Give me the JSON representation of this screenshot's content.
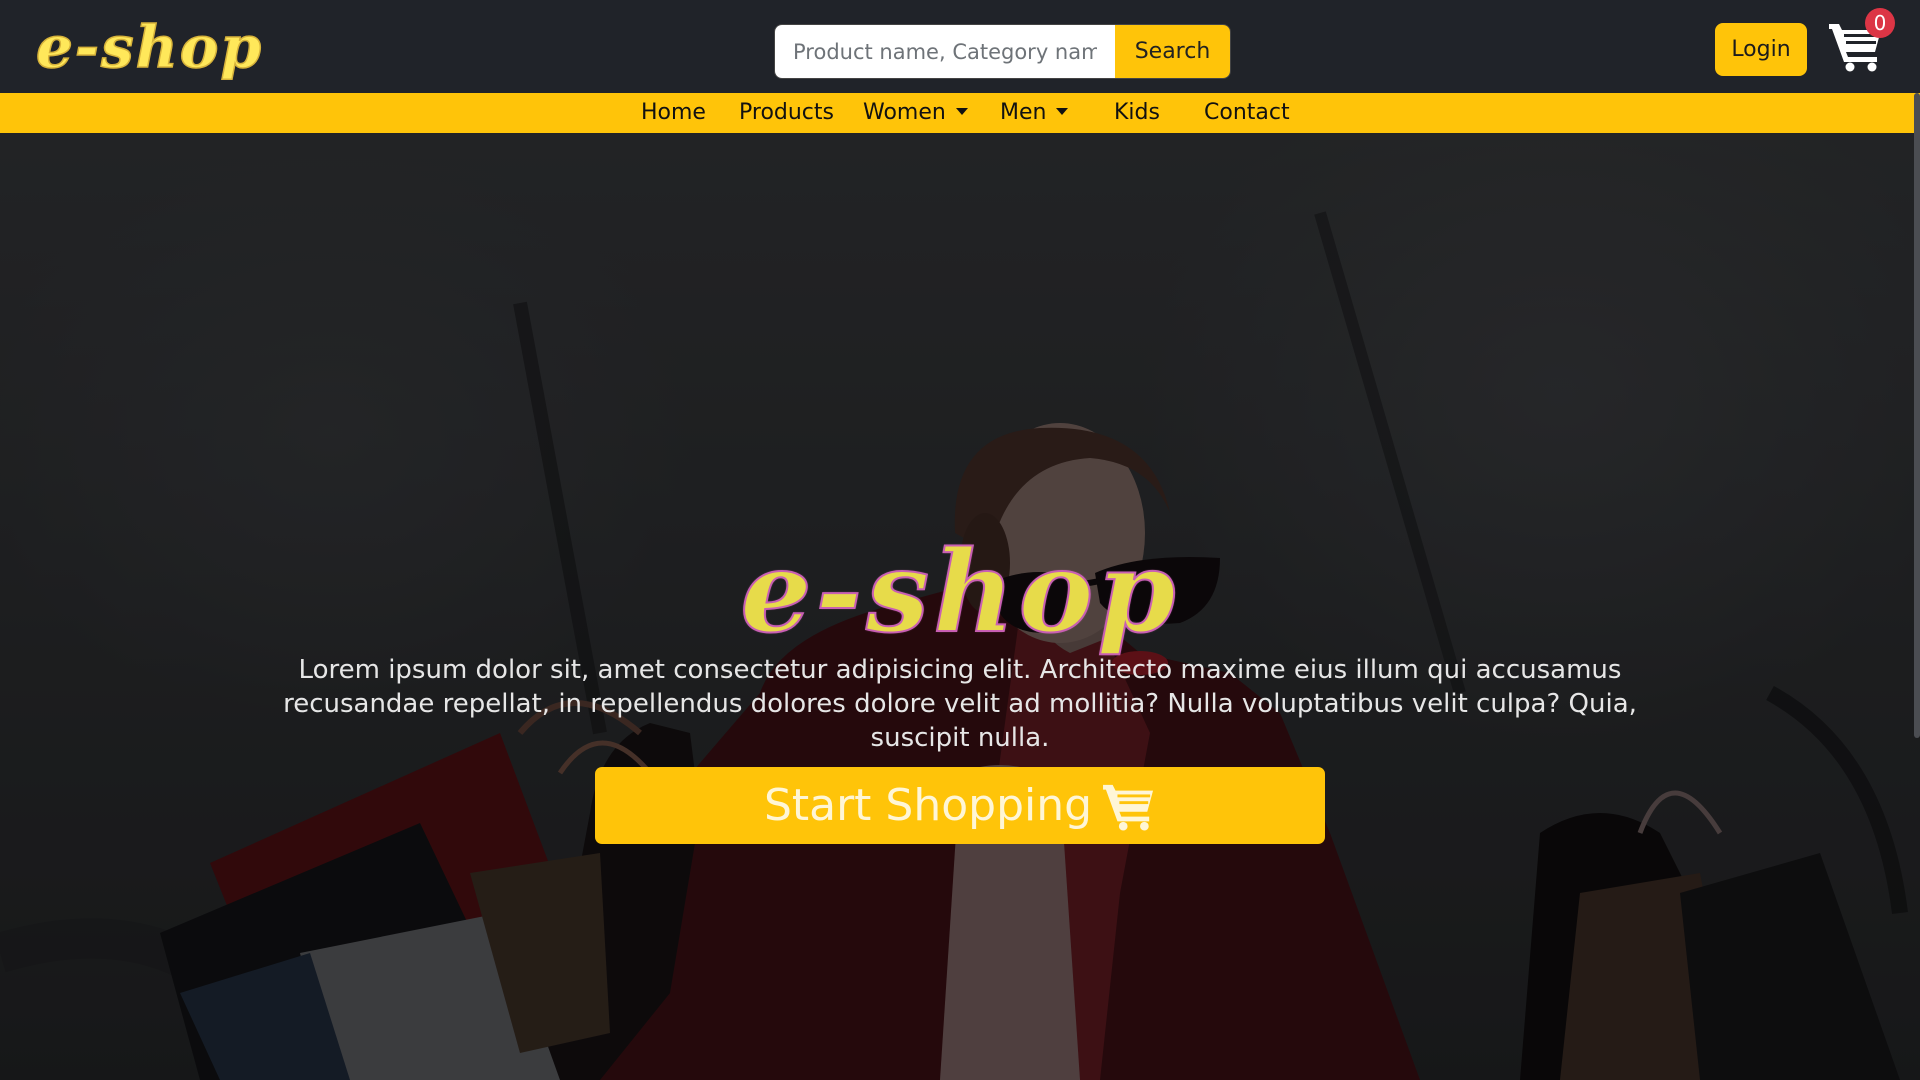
{
  "header": {
    "logo_text": "e-shop",
    "search": {
      "placeholder": "Product name, Category name",
      "value": "",
      "button_label": "Search"
    },
    "login_label": "Login",
    "cart": {
      "icon": "shopping-cart-icon",
      "count": "0"
    }
  },
  "nav": {
    "items": [
      {
        "label": "Home",
        "dropdown": false
      },
      {
        "label": "Products",
        "dropdown": false
      },
      {
        "label": "Women",
        "dropdown": true
      },
      {
        "label": "Men",
        "dropdown": true
      },
      {
        "label": "Kids",
        "dropdown": false
      },
      {
        "label": "Contact",
        "dropdown": false
      }
    ]
  },
  "hero": {
    "title": "e-shop",
    "text": "Lorem ipsum dolor sit, amet consectetur adipisicing elit. Architecto maxime eius illum qui accusamus recusandae repellat, in repellendus dolores dolore velit ad mollitia? Nulla voluptatibus velit culpa? Quia, suscipit nulla.",
    "cta_label": "Start Shopping",
    "cta_icon": "shopping-cart-icon"
  },
  "colors": {
    "topbar_bg": "#202329",
    "accent": "#ffc409",
    "badge": "#dc3545",
    "logo": "#ffe85a",
    "hero_title_outline": "#c85fb3"
  }
}
